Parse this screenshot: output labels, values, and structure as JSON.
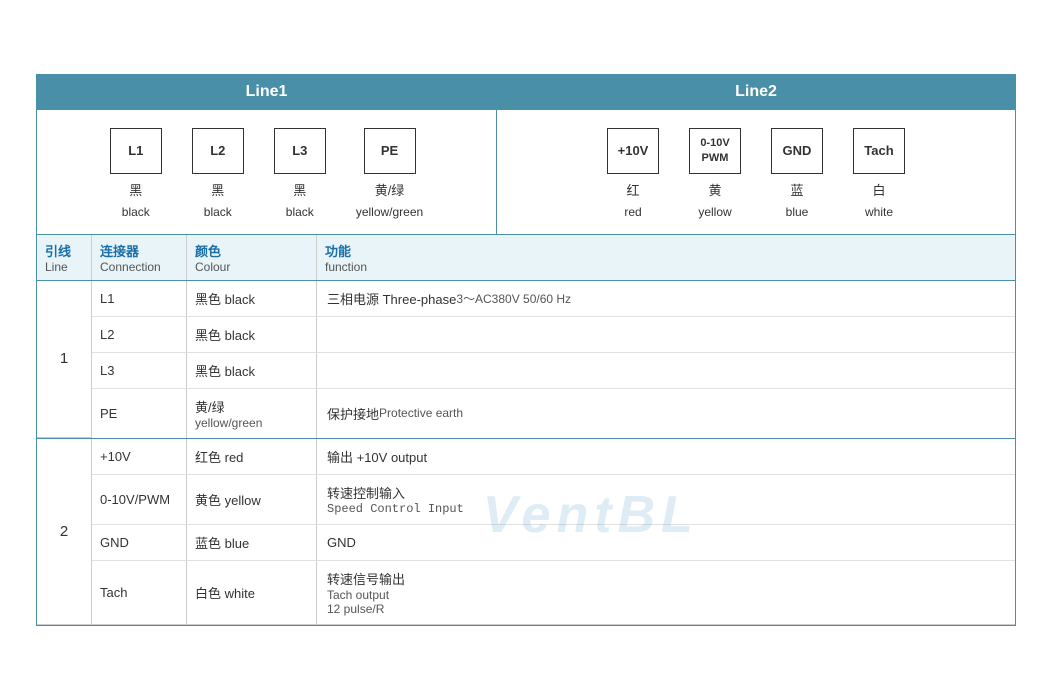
{
  "header": {
    "line1_label": "Line1",
    "line2_label": "Line2"
  },
  "line1_connectors": [
    {
      "id": "l1",
      "box_label": "L1",
      "label_cn": "黑",
      "label_en": "black"
    },
    {
      "id": "l2",
      "box_label": "L2",
      "label_cn": "黑",
      "label_en": "black"
    },
    {
      "id": "l3",
      "box_label": "L3",
      "label_cn": "黑",
      "label_en": "black"
    },
    {
      "id": "pe",
      "box_label": "PE",
      "label_cn": "黄/绿",
      "label_en": "yellow/green"
    }
  ],
  "line2_connectors": [
    {
      "id": "plus10v",
      "box_label": "+10V",
      "label_cn": "红",
      "label_en": "red"
    },
    {
      "id": "pwm",
      "box_label_line1": "0-10V",
      "box_label_line2": "PWM",
      "label_cn": "黄",
      "label_en": "yellow"
    },
    {
      "id": "gnd",
      "box_label": "GND",
      "label_cn": "蓝",
      "label_en": "blue"
    },
    {
      "id": "tach",
      "box_label": "Tach",
      "label_cn": "白",
      "label_en": "white"
    }
  ],
  "table_headers": {
    "line_cn": "引线",
    "line_en": "Line",
    "connection_cn": "连接器",
    "connection_en": "Connection",
    "colour_cn": "颜色",
    "colour_en": "Colour",
    "function_cn": "功能",
    "function_en": "function"
  },
  "groups": [
    {
      "line_num": "1",
      "rows": [
        {
          "connection": "L1",
          "colour_cn": "黑色 black",
          "function_cn": "三相电源 Three-phase",
          "function_en": "3～AC380V 50/60 Hz"
        },
        {
          "connection": "L2",
          "colour_cn": "黑色 black",
          "function_cn": "",
          "function_en": ""
        },
        {
          "connection": "L3",
          "colour_cn": "黑色 black",
          "function_cn": "",
          "function_en": ""
        },
        {
          "connection": "PE",
          "colour_cn": "黄/绿",
          "colour_en": "yellow/green",
          "function_cn": "保护接地",
          "function_en": "Protective earth"
        }
      ]
    },
    {
      "line_num": "2",
      "rows": [
        {
          "connection": "+10V",
          "colour_cn": "红色 red",
          "function_cn": "输出 +10V output",
          "function_en": ""
        },
        {
          "connection": "0-10V/PWM",
          "colour_cn": "黄色 yellow",
          "function_cn": "转速控制输入",
          "function_en": "Speed Control Input",
          "function_mono": true
        },
        {
          "connection": "GND",
          "colour_cn": "蓝色 blue",
          "function_cn": "GND",
          "function_en": ""
        },
        {
          "connection": "Tach",
          "colour_cn": "白色 white",
          "function_cn": "转速信号输出",
          "function_en": "Tach output",
          "function_extra": "12 pulse/R"
        }
      ]
    }
  ],
  "watermark": {
    "text": "VentBL"
  }
}
